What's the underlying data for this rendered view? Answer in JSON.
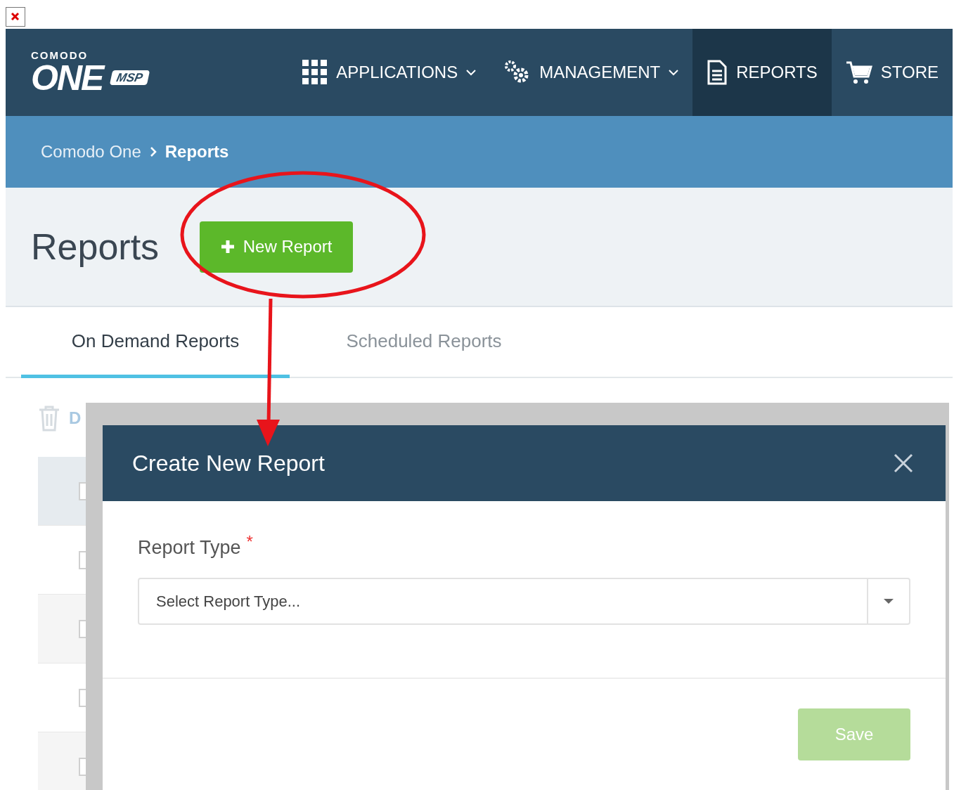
{
  "logo": {
    "top": "COMODO",
    "main": "ONE",
    "badge": "MSP"
  },
  "nav": [
    {
      "label": "APPLICATIONS",
      "kind": "grid",
      "dropdown": true,
      "selected": false
    },
    {
      "label": "MANAGEMENT",
      "kind": "gears",
      "dropdown": true,
      "selected": false
    },
    {
      "label": "REPORTS",
      "kind": "document",
      "dropdown": false,
      "selected": true
    },
    {
      "label": "STORE",
      "kind": "cart",
      "dropdown": false,
      "selected": false
    }
  ],
  "breadcrumb": [
    "Comodo One",
    "Reports"
  ],
  "page_title": "Reports",
  "new_button": "New Report",
  "tabs": [
    {
      "label": "On Demand Reports",
      "selected": true
    },
    {
      "label": "Scheduled Reports",
      "selected": false
    }
  ],
  "toolbar": {
    "delete_label": "D"
  },
  "rows": [
    {
      "selected": true
    },
    {
      "selected": false
    },
    {
      "selected": false
    },
    {
      "selected": false
    },
    {
      "selected": false
    }
  ],
  "dialog": {
    "title": "Create New Report",
    "field_label": "Report Type",
    "required_mark": "*",
    "placeholder": "Select Report Type...",
    "save": "Save",
    "save_disabled": true
  }
}
